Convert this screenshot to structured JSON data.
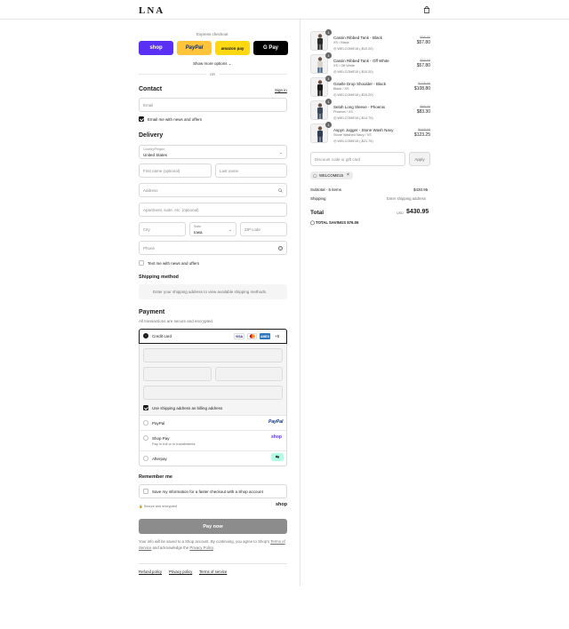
{
  "brand": {
    "logo_text": "LNA"
  },
  "express": {
    "title": "Express checkout",
    "buttons": [
      {
        "label": "shop",
        "bg": "#5a31f4",
        "fg": "#ffffff"
      },
      {
        "label": "PayPal",
        "bg": "#ffc439",
        "fg": "#003087"
      },
      {
        "label": "amazon pay",
        "bg": "#ffd814",
        "fg": "#111111"
      },
      {
        "label": "G Pay",
        "bg": "#000000",
        "fg": "#ffffff"
      }
    ],
    "show_more": "Show more options",
    "or": "OR"
  },
  "contact": {
    "title": "Contact",
    "sign_in": "Sign in",
    "email_placeholder": "Email",
    "newsletter_label": "Email me with news and offers",
    "newsletter_checked": true
  },
  "delivery": {
    "title": "Delivery",
    "country_label": "Country/Region",
    "country_value": "United States",
    "first_name_placeholder": "First name (optional)",
    "last_name_placeholder": "Last name",
    "address_placeholder": "Address",
    "apartment_placeholder": "Apartment, suite, etc. (optional)",
    "city_placeholder": "City",
    "state_label": "State",
    "state_value": "Iowa",
    "zip_placeholder": "ZIP code",
    "phone_placeholder": "Phone",
    "sms_label": "Text me with news and offers",
    "sms_checked": false
  },
  "shipping_method": {
    "title": "Shipping method",
    "notice": "Enter your shipping address to view available shipping methods."
  },
  "payment": {
    "title": "Payment",
    "subtitle": "All transactions are secure and encrypted.",
    "credit_card_label": "Credit card",
    "card_brands": [
      "VISA",
      "MC",
      "AMEX"
    ],
    "more_brands": "+5",
    "billing_label": "Use shipping address as billing address",
    "billing_checked": true,
    "options": [
      {
        "label": "PayPal",
        "logo": "PayPal",
        "sub": ""
      },
      {
        "label": "Shop Pay",
        "logo": "shop",
        "sub": "Pay in full or in installments"
      },
      {
        "label": "Afterpay",
        "logo": "afterpay-icon",
        "sub": ""
      }
    ]
  },
  "remember": {
    "title": "Remember me",
    "label": "Save my information for a faster checkout with a Shop account",
    "secure": "Secure and encrypted",
    "shop_logo": "shop"
  },
  "pay_button": "Pay now",
  "legal": {
    "line1": "Your info will be saved to a Shop account. By continuing, you agree to Shop's",
    "terms": "Terms of Service",
    "and": "and acknowledge the",
    "privacy": "Privacy Policy",
    "period": "."
  },
  "footer_links": [
    "Refund policy",
    "Privacy policy",
    "Terms of service"
  ],
  "order": {
    "items": [
      {
        "name": "Cassin Ribbed Tank - Black",
        "variant": "XS / Black",
        "discount": "WELCOME15 (-$10.20)",
        "old_price": "$68.00",
        "price": "$57.80",
        "qty": "1"
      },
      {
        "name": "Cassin Ribbed Tank - Off White",
        "variant": "XS / Off White",
        "discount": "WELCOME15 (-$10.20)",
        "old_price": "$68.00",
        "price": "$57.80",
        "qty": "1"
      },
      {
        "name": "Giselle Drop Shoulder - Black",
        "variant": "Black / XS",
        "discount": "WELCOME15 (-$19.20)",
        "old_price": "$128.00",
        "price": "$108.80",
        "qty": "1"
      },
      {
        "name": "Selah Long Sleeve - Phoenix",
        "variant": "Phoenix / XS",
        "discount": "WELCOME15 (-$14.70)",
        "old_price": "$98.00",
        "price": "$83.30",
        "qty": "1"
      },
      {
        "name": "Aspyn Jogger - Stone Wash Navy",
        "variant": "Stone Washed Navy / XS",
        "discount": "WELCOME15 (-$21.75)",
        "old_price": "$145.00",
        "price": "$123.25",
        "qty": "1"
      }
    ],
    "discount_placeholder": "Discount code or gift card",
    "apply": "Apply",
    "applied_code": "WELCOME15",
    "subtotal_label": "Subtotal · 5 items",
    "subtotal_value": "$430.95",
    "shipping_label": "Shipping",
    "shipping_value": "Enter shipping address",
    "total_label": "Total",
    "currency": "USD",
    "total_value": "$430.95",
    "savings_label": "TOTAL SAVINGS",
    "savings_value": "$76.05"
  }
}
